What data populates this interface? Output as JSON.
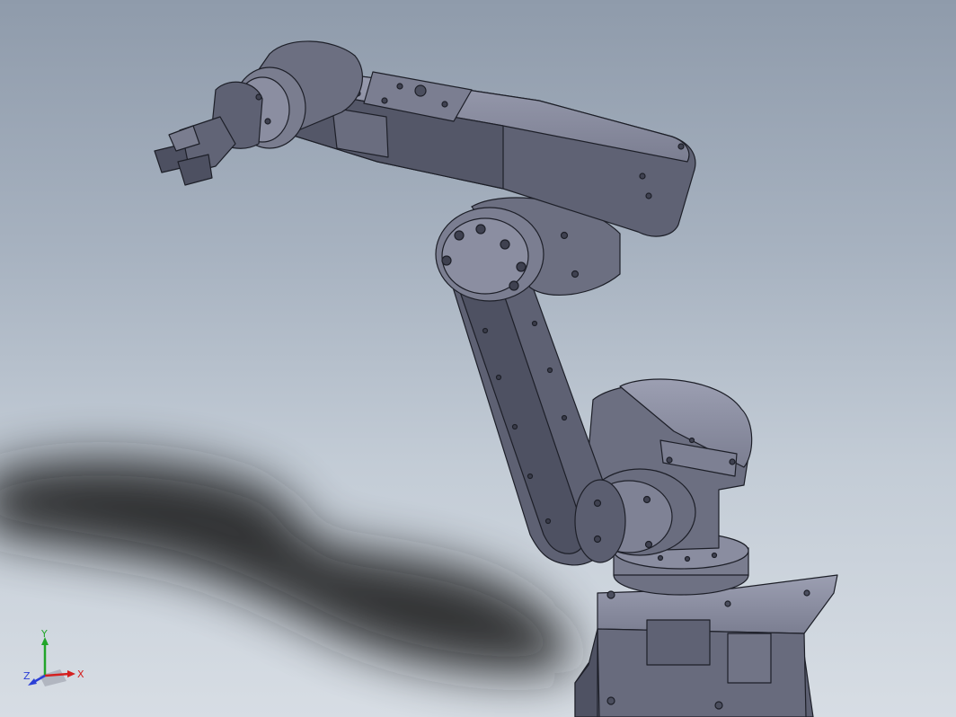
{
  "viewport": {
    "background_top": "#8f9bab",
    "background_bottom": "#d7dde4",
    "model_color": "#6b6e80",
    "model_edge_color": "#1d1f28"
  },
  "triad": {
    "x_label": "X",
    "y_label": "Y",
    "z_label": "Z",
    "x_color": "#d42020",
    "y_color": "#22a52a",
    "z_color": "#2b3fd6"
  }
}
